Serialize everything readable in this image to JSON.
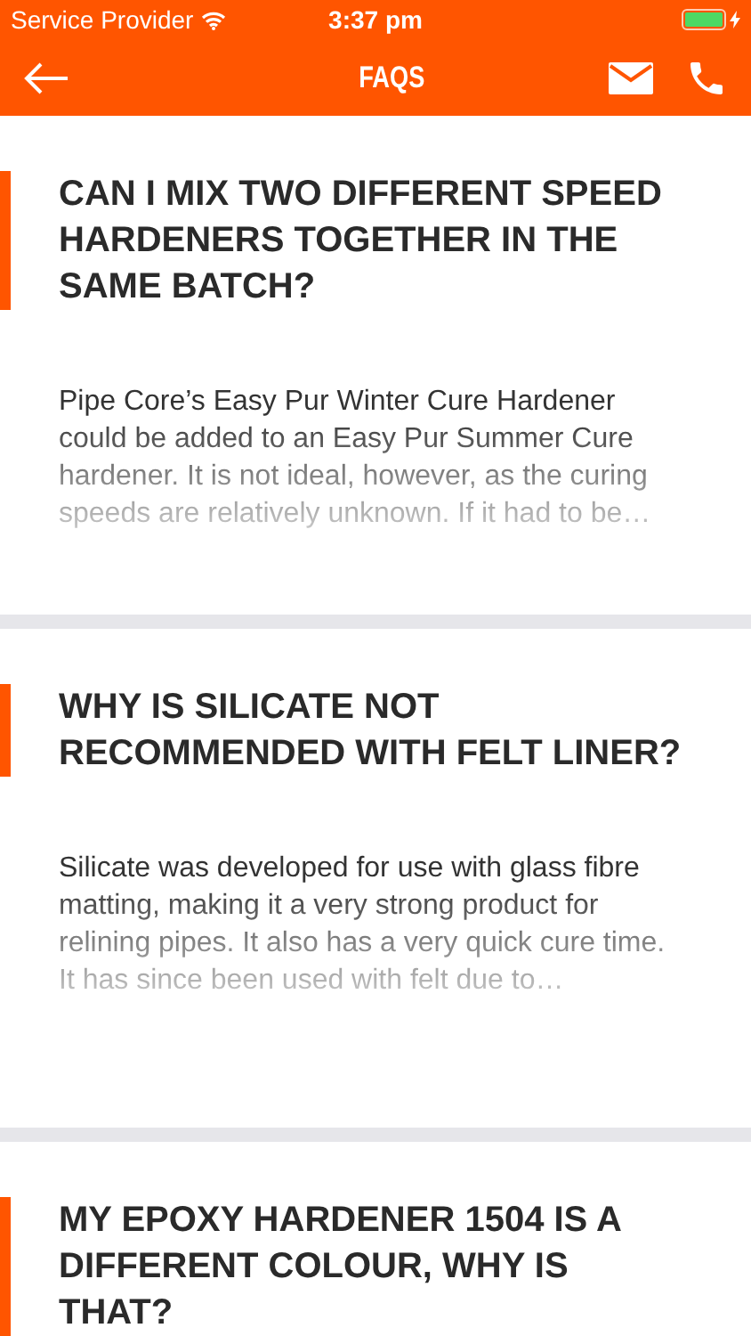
{
  "status_bar": {
    "carrier": "Service Provider",
    "time": "3:37 pm"
  },
  "header": {
    "title": "FAQS"
  },
  "faqs": [
    {
      "question": "CAN I MIX TWO DIFFERENT SPEED HARDENERS TOGETHER IN THE SAME BATCH?",
      "answer": "Pipe Core’s Easy Pur Winter Cure Hardener could be added to an Easy Pur Summer Cure hardener. It is not ideal, however, as the curing speeds are relatively unknown. If it had to be…"
    },
    {
      "question": "WHY IS SILICATE NOT RECOMMENDED WITH FELT LINER?",
      "answer": "Silicate was developed for use with glass fibre matting, making it a very strong product for relining pipes. It also has a very quick cure time. It has since been used with felt due to…"
    },
    {
      "question": "MY EPOXY HARDENER 1504 IS A DIFFERENT COLOUR, WHY IS THAT?"
    }
  ]
}
